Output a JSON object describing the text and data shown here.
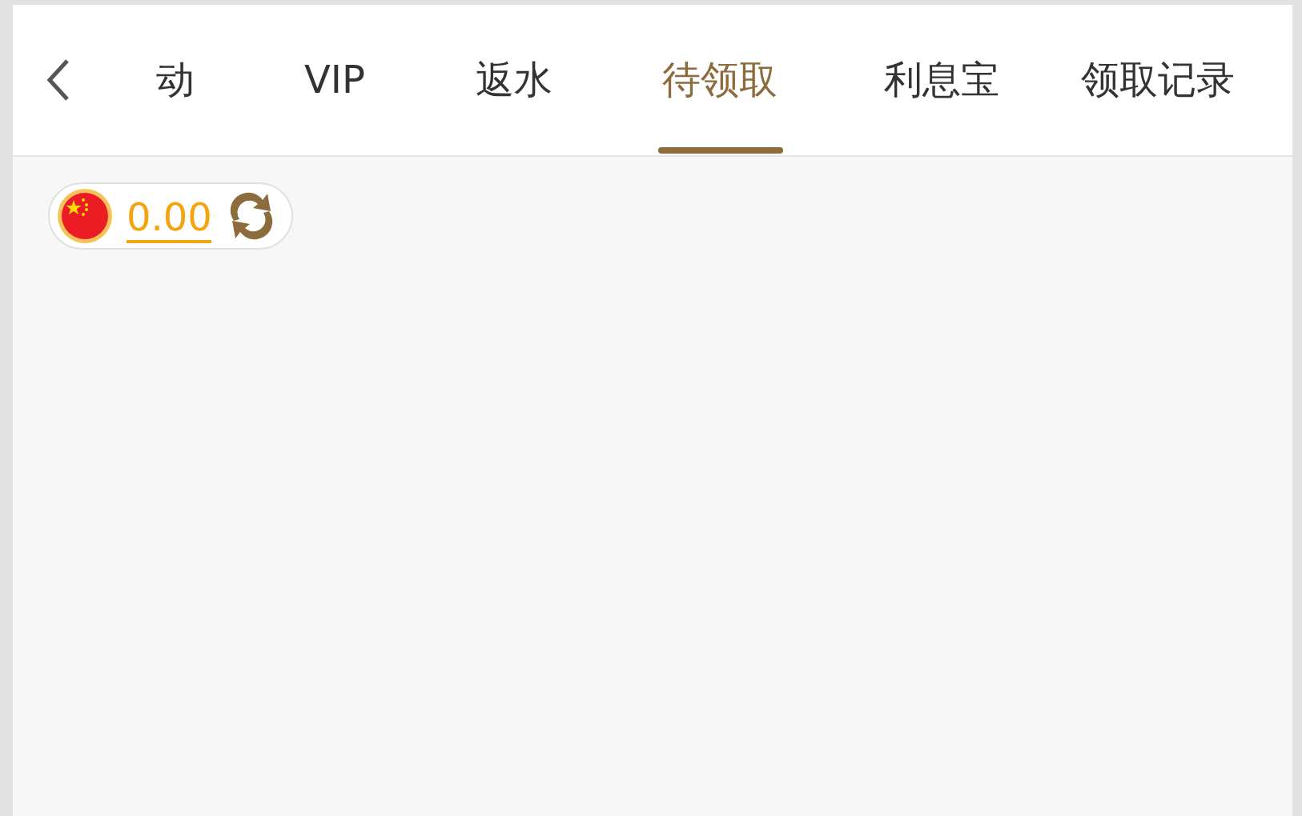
{
  "tabs": [
    {
      "label": "动",
      "selected": false
    },
    {
      "label": "VIP",
      "selected": false
    },
    {
      "label": "返水",
      "selected": false
    },
    {
      "label": "待领取",
      "selected": true
    },
    {
      "label": "利息宝",
      "selected": false
    },
    {
      "label": "领取记录",
      "selected": false
    }
  ],
  "balance": {
    "amount": "0.00"
  }
}
